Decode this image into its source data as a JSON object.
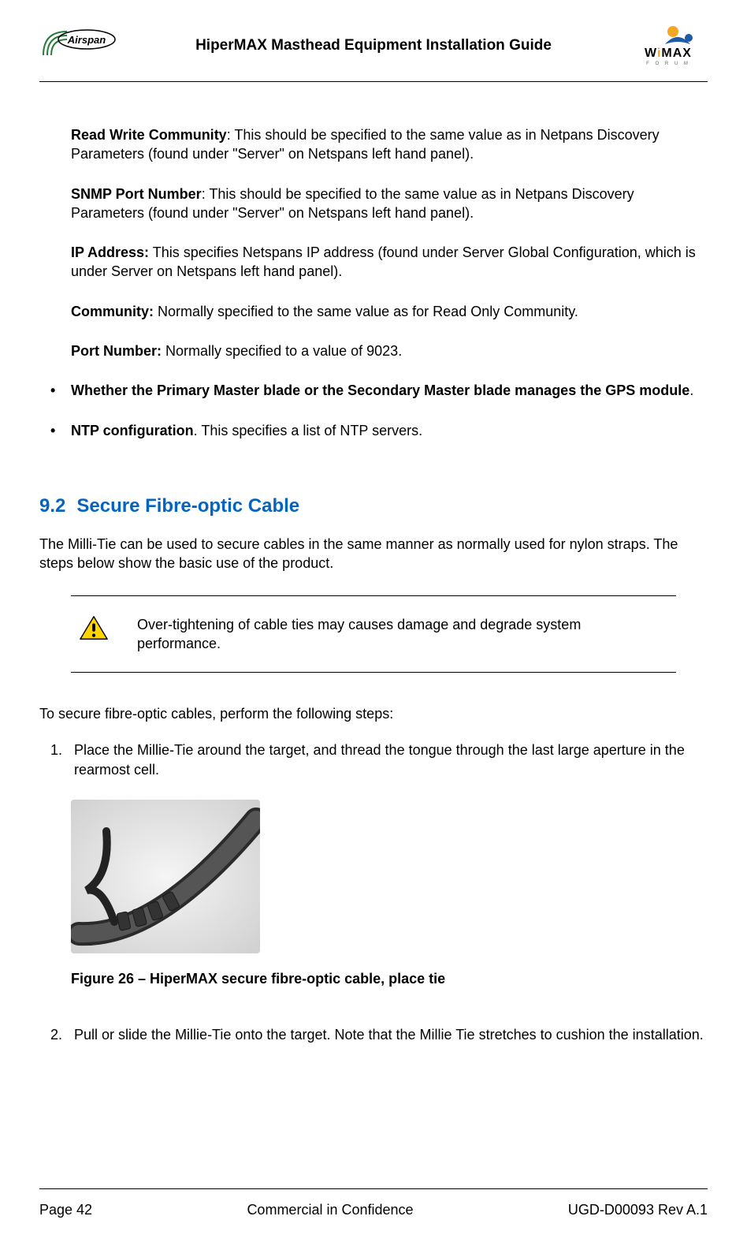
{
  "header": {
    "title": "HiperMAX Masthead Equipment Installation Guide",
    "logo_left_name": "Airspan",
    "logo_right_top": "WiMAX",
    "logo_right_sub": "FORUM"
  },
  "defs": [
    {
      "label": "Read Write Community",
      "sep": ":  ",
      "text": "This should be specified to the same value as in Netpans Discovery Parameters (found under \"Server\" on Netspans left hand panel)."
    },
    {
      "label": "SNMP Port Number",
      "sep": ":  ",
      "text": "This should be specified to the same value as in Netpans Discovery Parameters (found under \"Server\" on Netspans left hand panel)."
    },
    {
      "label": "IP Address:",
      "sep": "  ",
      "text": "This specifies Netspans IP address (found under Server Global Configuration, which is under Server on Netspans left hand panel)."
    },
    {
      "label": "Community:",
      "sep": "  ",
      "text": "Normally specified to the same value as for Read Only Community."
    },
    {
      "label": "Port Number:",
      "sep": "  ",
      "text": "Normally specified to a value of 9023."
    }
  ],
  "bullets": [
    {
      "bold": "Whether the Primary Master blade or the Secondary Master blade manages the GPS module",
      "tail": "."
    },
    {
      "bold": "NTP configuration",
      "tail": ".  This specifies a list of NTP servers."
    }
  ],
  "section": {
    "num": "9.2",
    "title": "Secure Fibre-optic Cable",
    "intro": "The Milli-Tie can be used to secure cables in the same manner as normally used for nylon straps.  The steps below show the basic use of the product.",
    "warning": "Over-tightening of cable ties may causes damage and degrade system performance.",
    "steps_intro": "To secure fibre-optic cables, perform the following steps:",
    "steps": [
      {
        "n": "1.",
        "text": "Place the Millie-Tie around the target, and thread the tongue through the last large aperture in the rearmost cell."
      },
      {
        "n": "2.",
        "text": "Pull or slide the Millie-Tie onto the target.  Note that the Millie Tie stretches to cushion the installation."
      }
    ],
    "figure_caption": "Figure 26 – HiperMAX secure fibre-optic cable, place tie"
  },
  "footer": {
    "left": "Page 42",
    "center": "Commercial in Confidence",
    "right": "UGD-D00093 Rev A.1"
  }
}
